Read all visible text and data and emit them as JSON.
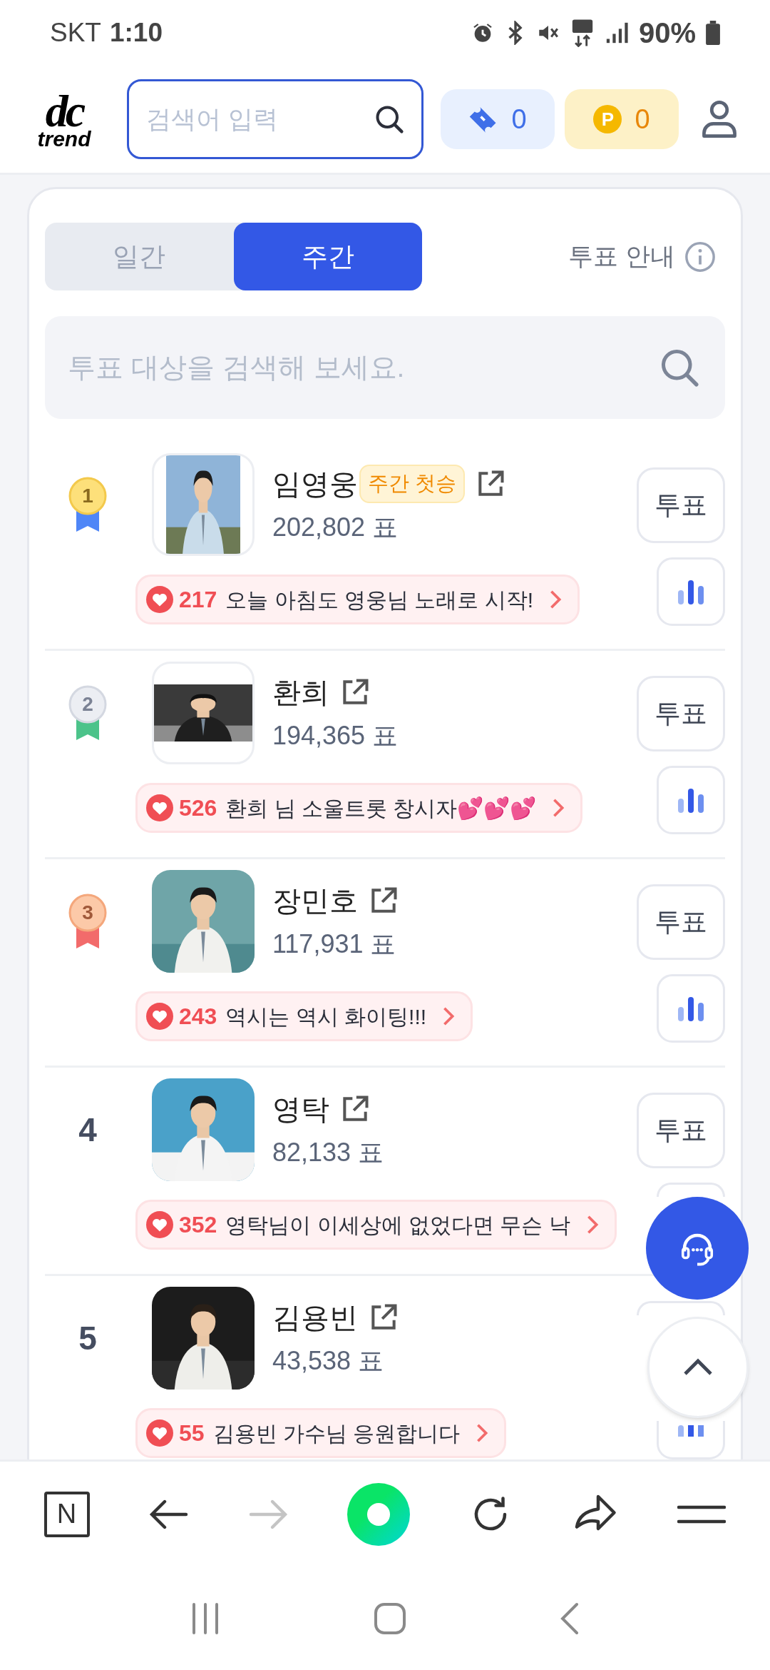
{
  "status_bar": {
    "carrier": "SKT",
    "time": "1:10",
    "battery": "90%"
  },
  "header": {
    "logo_top": "dc",
    "logo_bottom": "trend",
    "search": {
      "placeholder": "검색어 입력"
    },
    "tickets": "0",
    "points": {
      "coin": "P",
      "value": "0"
    }
  },
  "period_tabs": [
    {
      "label": "일간",
      "selected": false
    },
    {
      "label": "주간",
      "selected": true
    }
  ],
  "vote_guide": "투표 안내",
  "vote_search": {
    "placeholder": "투표 대상을 검색해 보세요."
  },
  "ranking": [
    {
      "rank": "1",
      "kind": "medal",
      "color": "#4f86f7",
      "name": "임영웅",
      "badge": "주간 첫승",
      "votes": "202,802 표",
      "likes": "217",
      "comment": "오늘 아침도 영웅님 노래로 시작!",
      "vote_button": "투표"
    },
    {
      "rank": "2",
      "kind": "medal",
      "color": "#4cc38a",
      "name": "환희",
      "votes": "194,365 표",
      "likes": "526",
      "comment": "환희 님 소울트롯 창시자💕💕💕",
      "vote_button": "투표"
    },
    {
      "rank": "3",
      "kind": "medal",
      "color": "#f26b6b",
      "name": "장민호",
      "votes": "117,931 표",
      "likes": "243",
      "comment": "역시는 역시 화이팅!!!",
      "vote_button": "투표"
    },
    {
      "rank": "4",
      "kind": "number",
      "name": "영탁",
      "votes": "82,133 표",
      "likes": "352",
      "comment": "영탁님이 이세상에 없었다면 무슨 낙",
      "vote_button": "투표"
    },
    {
      "rank": "5",
      "kind": "number",
      "name": "김용빈",
      "votes": "43,538 표",
      "likes": "55",
      "comment": "김용빈 가수님 응원합니다"
    }
  ],
  "browser_bar": {
    "home": "N",
    "forward_disabled": true
  }
}
